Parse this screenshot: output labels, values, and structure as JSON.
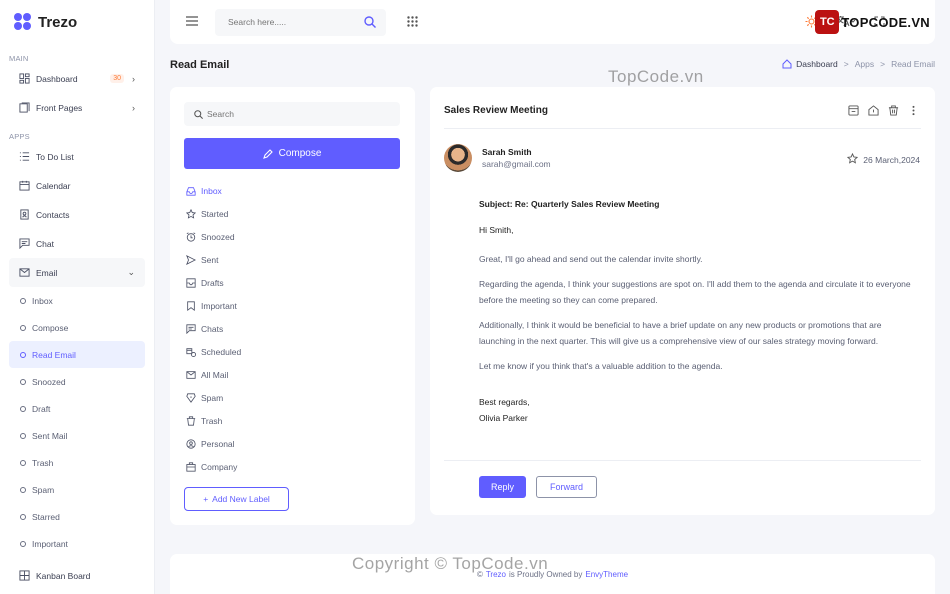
{
  "app": {
    "name": "Trezo"
  },
  "sidebar": {
    "sections": {
      "main": "MAIN",
      "apps": "APPS"
    },
    "main_items": [
      {
        "label": "Dashboard",
        "badge": "30",
        "icon": "dashboard-icon"
      },
      {
        "label": "Front Pages",
        "icon": "front-pages-icon"
      }
    ],
    "app_items": [
      {
        "label": "To Do List",
        "icon": "list-icon"
      },
      {
        "label": "Calendar",
        "icon": "calendar-icon"
      },
      {
        "label": "Contacts",
        "icon": "contacts-icon"
      },
      {
        "label": "Chat",
        "icon": "chat-icon"
      },
      {
        "label": "Email",
        "icon": "mail-icon"
      }
    ],
    "email_sub": [
      {
        "label": "Inbox"
      },
      {
        "label": "Compose"
      },
      {
        "label": "Read Email",
        "active": true
      },
      {
        "label": "Snoozed"
      },
      {
        "label": "Draft"
      },
      {
        "label": "Sent Mail"
      },
      {
        "label": "Trash"
      },
      {
        "label": "Spam"
      },
      {
        "label": "Starred"
      },
      {
        "label": "Important"
      }
    ],
    "kanban": {
      "label": "Kanban Board",
      "icon": "kanban-icon"
    }
  },
  "header": {
    "search_placeholder": "Search here.....",
    "brand_badge": "TC",
    "brand_text": "TOPCODE.VN"
  },
  "page": {
    "title": "Read Email",
    "breadcrumb": [
      "Dashboard",
      "Apps",
      "Read Email"
    ]
  },
  "mail_nav": {
    "search_placeholder": "Search",
    "compose_label": "Compose",
    "items": [
      {
        "label": "Inbox",
        "active": true
      },
      {
        "label": "Started"
      },
      {
        "label": "Snoozed"
      },
      {
        "label": "Sent"
      },
      {
        "label": "Drafts"
      },
      {
        "label": "Important"
      },
      {
        "label": "Chats"
      },
      {
        "label": "Scheduled"
      },
      {
        "label": "All Mail"
      },
      {
        "label": "Spam"
      },
      {
        "label": "Trash"
      },
      {
        "label": "Personal"
      },
      {
        "label": "Company"
      }
    ],
    "add_label": "Add New Label"
  },
  "email": {
    "title": "Sales Review Meeting",
    "sender_name": "Sarah Smith",
    "sender_email": "sarah@gmail.com",
    "date": "26 March,2024",
    "subject": "Subject: Re: Quarterly Sales Review Meeting",
    "greeting": "Hi Smith,",
    "paragraphs": [
      "Great, I'll go ahead and send out the calendar invite shortly.",
      "Regarding the agenda, I think your suggestions are spot on. I'll add them to the agenda and circulate it to everyone before the meeting so they can come prepared.",
      "Additionally, I think it would be beneficial to have a brief update on any new products or promotions that are launching in the next quarter. This will give us a comprehensive view of our sales strategy moving forward.",
      "Let me know if you think that's a valuable addition to the agenda."
    ],
    "signoff": "Best regards,",
    "signature": "Olivia Parker",
    "reply_label": "Reply",
    "forward_label": "Forward"
  },
  "footer": {
    "copyright": "©",
    "brand": "Trezo",
    "middle": "is Proudly Owned by",
    "owner": "EnvyTheme"
  },
  "watermark": {
    "text": "TopCode.vn",
    "footer_text": "Copyright © TopCode.vn"
  }
}
